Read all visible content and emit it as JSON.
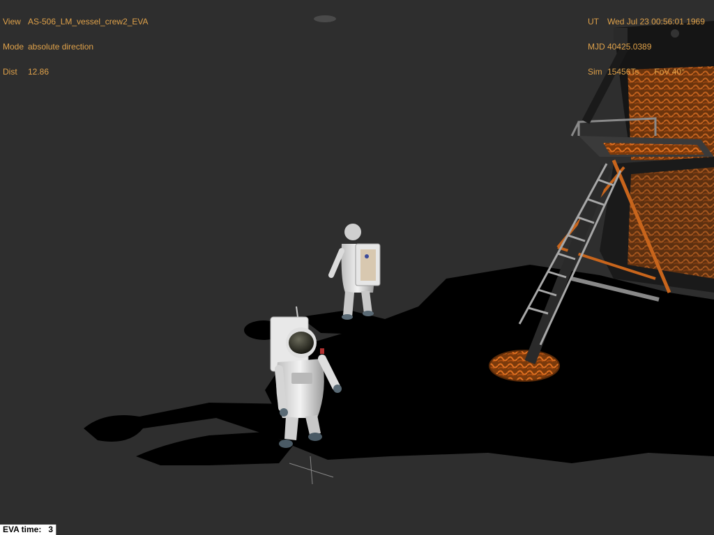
{
  "hud_left": {
    "view_key": "View",
    "view_value": "AS-506_LM_vessel_crew2_EVA",
    "mode_key": "Mode",
    "mode_value": "absolute direction",
    "dist_key": "Dist",
    "dist_value": "12.86"
  },
  "hud_right": {
    "ut_key": "UT",
    "ut_value": "Wed Jul 23 00:56:01 1969",
    "mjd_key": "MJD",
    "mjd_value": "40425.0389",
    "sim_key": "Sim",
    "sim_value": "15456Ts",
    "fov_key": "FoV",
    "fov_value": "40°"
  },
  "eva": {
    "label": "EVA time:",
    "value": "3"
  },
  "colors": {
    "hud_text": "#e0a24a",
    "ground": "#2e2e2e",
    "shadow": "#000000",
    "foil": "#c8651c"
  }
}
